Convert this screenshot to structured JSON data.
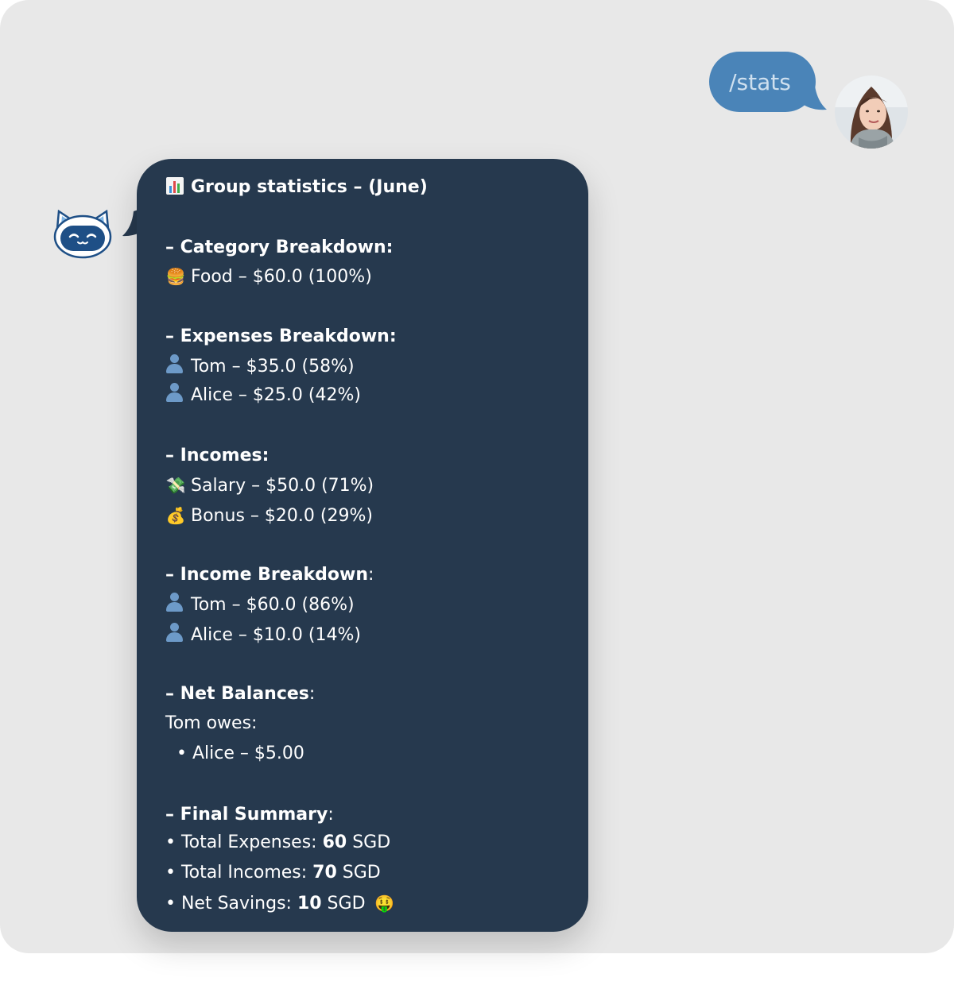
{
  "user_message": {
    "text": "/stats"
  },
  "bot_message": {
    "title": "Group statistics – (June)",
    "category_header": "– Category Breakdown:",
    "category_items": [
      "Food – $60.0 (100%)"
    ],
    "expenses_header": "– Expenses Breakdown:",
    "expenses_items": [
      "Tom – $35.0 (58%)",
      "Alice – $25.0 (42%)"
    ],
    "incomes_header": "– Incomes:",
    "incomes_items": [
      "Salary – $50.0 (71%)",
      "Bonus – $20.0 (29%)"
    ],
    "income_breakdown_header_bold": "– Income Breakdown",
    "income_breakdown_items": [
      "Tom – $60.0 (86%)",
      "Alice – $10.0 (14%)"
    ],
    "net_balances_header_bold": "– Net Balances",
    "owes_line": "Tom owes:",
    "owes_item": "• Alice – $5.00",
    "final_header_bold": "– Final Summary",
    "summary": [
      {
        "label": "• Total Expenses: ",
        "value": "60",
        "unit": " SGD"
      },
      {
        "label": "• Total Incomes: ",
        "value": "70",
        "unit": " SGD"
      },
      {
        "label": "• Net Savings: ",
        "value": "10",
        "unit": " SGD"
      }
    ]
  },
  "icons": {
    "title": "bar-chart-icon",
    "food": "burger-icon",
    "person": "person-icon",
    "salary": "money-with-wings-icon",
    "bonus": "money-bag-icon",
    "savings": "money-mouth-face-icon",
    "bot": "cat-robot-icon"
  },
  "colors": {
    "background": "#e8e8e8",
    "user_bubble": "#4a84b8",
    "bot_bubble": "#26394e",
    "text": "#ffffff"
  }
}
